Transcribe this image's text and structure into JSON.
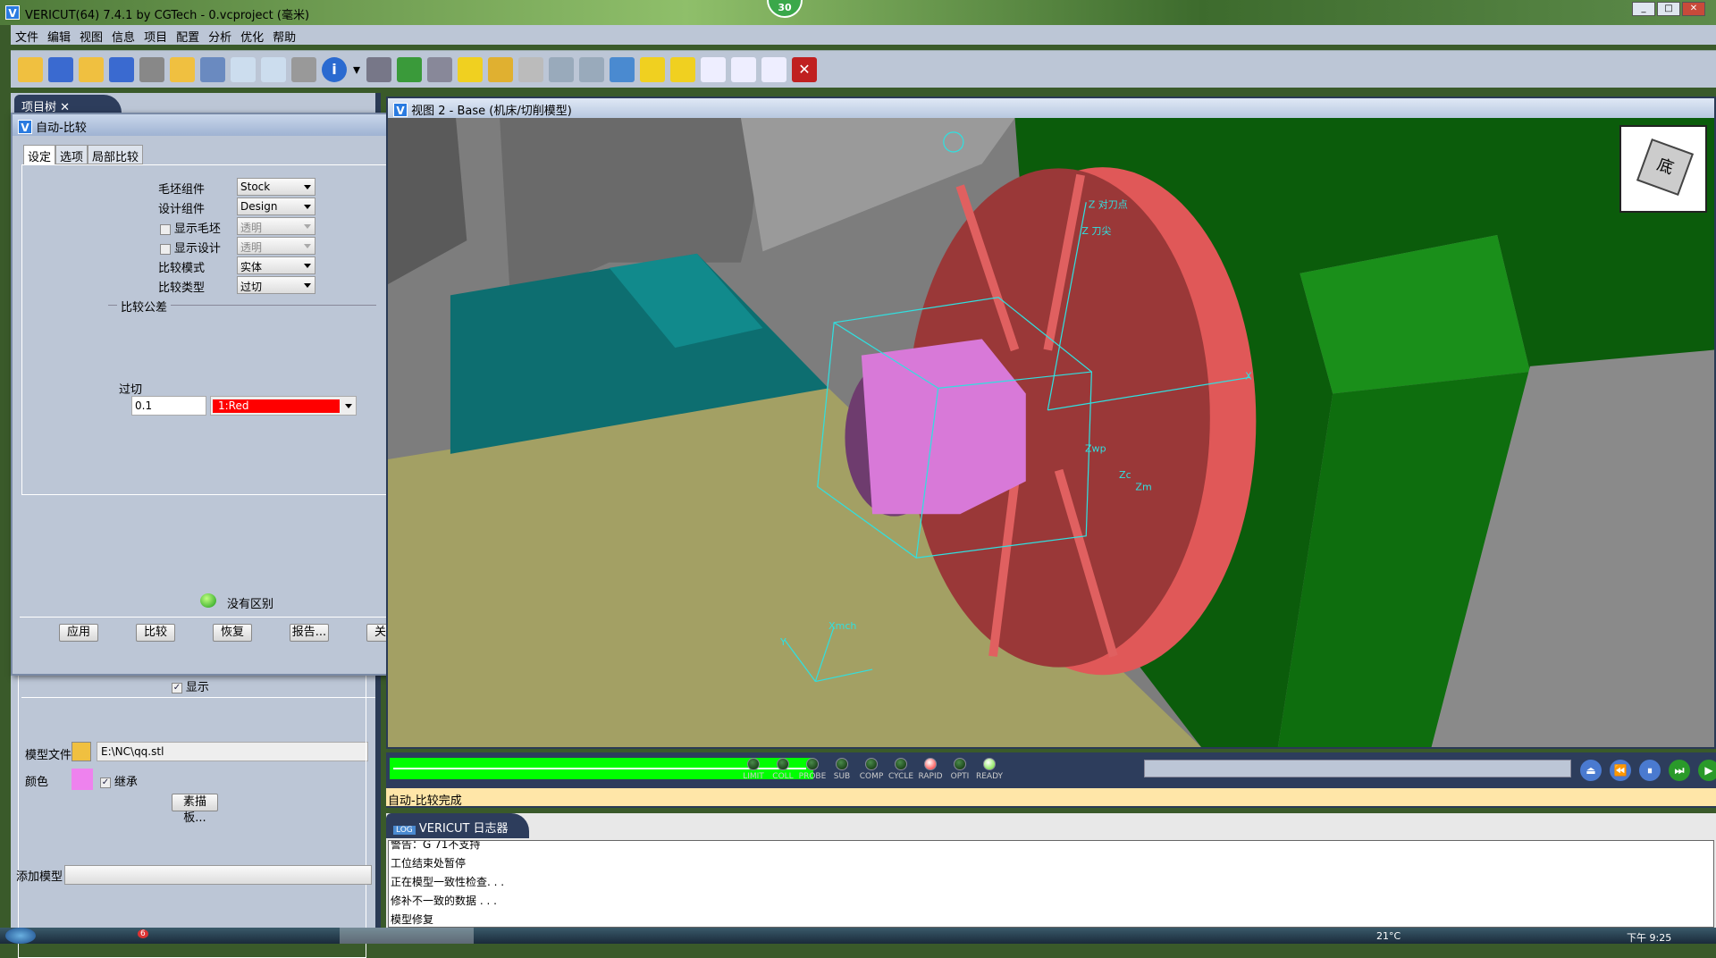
{
  "window": {
    "title": "VERICUT(64)  7.4.1 by CGTech - 0.vcproject (毫米)",
    "badge": "30"
  },
  "menu": [
    "文件",
    "编辑",
    "视图",
    "信息",
    "项目",
    "配置",
    "分析",
    "优化",
    "帮助"
  ],
  "toolbar_icons": [
    "open-vc-icon",
    "save-vc-icon",
    "open-ip-icon",
    "save-ip-icon",
    "tool-icon",
    "open-folder-check-icon",
    "tree-icon",
    "nc-program-icon",
    "nc-check-icon",
    "nc-disabled-icon",
    "info-icon",
    "dropdown-arrow-icon",
    "hand-icon",
    "machine-icon",
    "tool-manager-icon",
    "color-icon",
    "cut-icon",
    "zoom-box-icon",
    "zoom-in-icon",
    "zoom-out-icon",
    "fit-icon",
    "sphere-icon",
    "rotate-icon",
    "single-view-icon",
    "split-vertical-icon",
    "split-horizontal-icon",
    "close-view-icon"
  ],
  "project_tree": {
    "tab": "项目树",
    "show_label": "显示",
    "show_checked": true,
    "model_file_label": "模型文件",
    "model_file_value": "E:\\NC\\qq.stl",
    "color_label": "颜色",
    "color_value": "#ee82ee",
    "inherit_label": "继承",
    "inherit_checked": true,
    "sketch_button": "素描板...",
    "add_model_label": "添加模型",
    "add_model_value": ""
  },
  "dialog": {
    "title": "自动-比较",
    "tabs": [
      "设定",
      "选项",
      "局部比较"
    ],
    "stock_label": "毛坯组件",
    "stock_value": "Stock",
    "design_label": "设计组件",
    "design_value": "Design",
    "show_stock_label": "显示毛坯",
    "show_stock_value": "透明",
    "show_design_label": "显示设计",
    "show_design_value": "透明",
    "mode_label": "比较模式",
    "mode_value": "实体",
    "type_label": "比较类型",
    "type_value": "过切",
    "tolerance_group": "比较公差",
    "gouge_label": "过切",
    "gouge_value": "0.1",
    "gouge_color": "1:Red",
    "gouge_color_hex": "#ff0000",
    "result_text": "没有区别",
    "buttons": [
      "应用",
      "比较",
      "恢复",
      "报告...",
      "关闭"
    ]
  },
  "viewport": {
    "title": "视图 2 - Base (机床/切削模型)",
    "cube_label": "底",
    "axis_labels": [
      "Z 对刀点",
      "Z 刀尖",
      "Zwp",
      "Zc",
      "Zm",
      "Xmch",
      "X",
      "Y"
    ]
  },
  "controls": {
    "progress_percent": 100,
    "leds": [
      {
        "label": "LIMIT",
        "on": false
      },
      {
        "label": "COLL",
        "on": false
      },
      {
        "label": "PROBE",
        "on": false
      },
      {
        "label": "SUB",
        "on": false
      },
      {
        "label": "COMP",
        "on": false
      },
      {
        "label": "CYCLE",
        "on": false
      },
      {
        "label": "RAPID",
        "on": true,
        "color": "#ff2020"
      },
      {
        "label": "OPTI",
        "on": false
      },
      {
        "label": "READY",
        "on": true,
        "color": "#60e020"
      }
    ]
  },
  "status": "自动-比较完成",
  "logger": {
    "title": "VERICUT 日志器",
    "lines": [
      "警告：G 71不支持",
      "工位结束处暂停",
      "正在模型一致性检查. . .",
      "修补不一致的数据  . . .",
      "模型修复"
    ]
  },
  "taskbar": {
    "temperature": "21°C",
    "time": "下午 9:25",
    "notification_count": "6"
  }
}
